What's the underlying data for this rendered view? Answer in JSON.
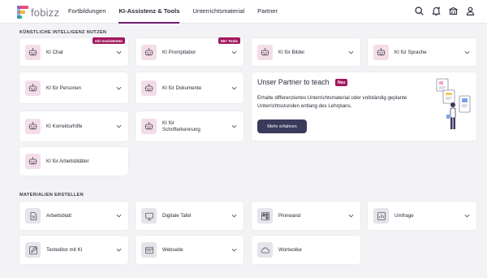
{
  "brand": {
    "name": "fobizz"
  },
  "nav": [
    {
      "label": "Fortbildungen",
      "active": false
    },
    {
      "label": "KI-Assistenz & Tools",
      "active": true
    },
    {
      "label": "Unterrichtsmaterial",
      "active": false
    },
    {
      "label": "Partner",
      "active": false
    }
  ],
  "header_icons": [
    "search-icon",
    "bell-icon",
    "school-icon",
    "user-icon"
  ],
  "sections": {
    "ki": "KÜNSTLICHE INTELLIGENZ NUTZEN",
    "materialien": "MATERIALIEN ERSTELLEN"
  },
  "ki_cards": [
    {
      "label": "KI Chat",
      "badge": "mit Assistenten",
      "icon": "robot-icon"
    },
    {
      "label": "KI Promptlabor",
      "badge": "55+ Tools",
      "icon": "robot-icon"
    },
    {
      "label": "KI für Bilder",
      "icon": "robot-icon"
    },
    {
      "label": "KI für Sprache",
      "icon": "robot-icon"
    },
    {
      "label": "KI für Personen",
      "icon": "robot-icon"
    },
    {
      "label": "KI für Dokumente",
      "icon": "robot-icon"
    },
    {
      "label": "KI Korrekturhilfe",
      "icon": "robot-icon"
    },
    {
      "label": "KI für\nSchrifterkennung",
      "icon": "robot-icon"
    },
    {
      "label": "KI für Arbeitsblätter",
      "icon": "robot-icon"
    }
  ],
  "partner": {
    "title": "Unser Partner to teach",
    "badge": "Neu",
    "text": "Erhalte differenziertes Unterrichtsmaterial oder vollständig geplante Unterrichtsstunden entlang des Lehrplans.",
    "button": "Mehr erfahren"
  },
  "material_cards": [
    {
      "label": "Arbeitsblatt",
      "icon": "worksheet-icon"
    },
    {
      "label": "Digitale Tafel",
      "icon": "board-icon"
    },
    {
      "label": "Pinnwand",
      "icon": "pinboard-icon"
    },
    {
      "label": "Umfrage",
      "icon": "poll-icon"
    },
    {
      "label": "Texteditor mit KI",
      "icon": "pen-icon"
    },
    {
      "label": "Webseite",
      "icon": "webpage-icon"
    },
    {
      "label": "Wortwolke",
      "icon": "cloud-icon"
    }
  ],
  "colors": {
    "accent": "#6c1f6e",
    "badge": "#a3185e",
    "button": "#3a3b5c",
    "pink_tile": "#f4dde8",
    "gray_tile": "#e4e4ea"
  }
}
